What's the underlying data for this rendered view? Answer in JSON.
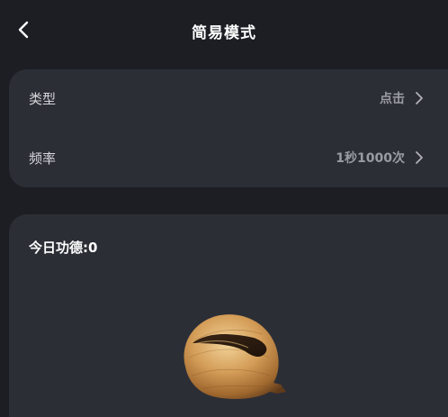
{
  "header": {
    "title": "简易模式",
    "back_icon": "chevron-left-icon"
  },
  "settings": {
    "type": {
      "label": "类型",
      "value": "点击"
    },
    "frequency": {
      "label": "频率",
      "value": "1秒1000次"
    },
    "chevron_icon": "chevron-right-icon"
  },
  "merit": {
    "label": "今日功德:",
    "count": "0"
  },
  "woodfish": {
    "icon": "wooden-fish-icon",
    "colors": {
      "light": "#e8c48a",
      "mid": "#c08a4a",
      "dark": "#6e4420"
    }
  },
  "colors": {
    "background": "#1c1e24",
    "card": "#2c2e36",
    "text_primary": "#ffffff",
    "text_secondary": "#9a9ca3"
  }
}
